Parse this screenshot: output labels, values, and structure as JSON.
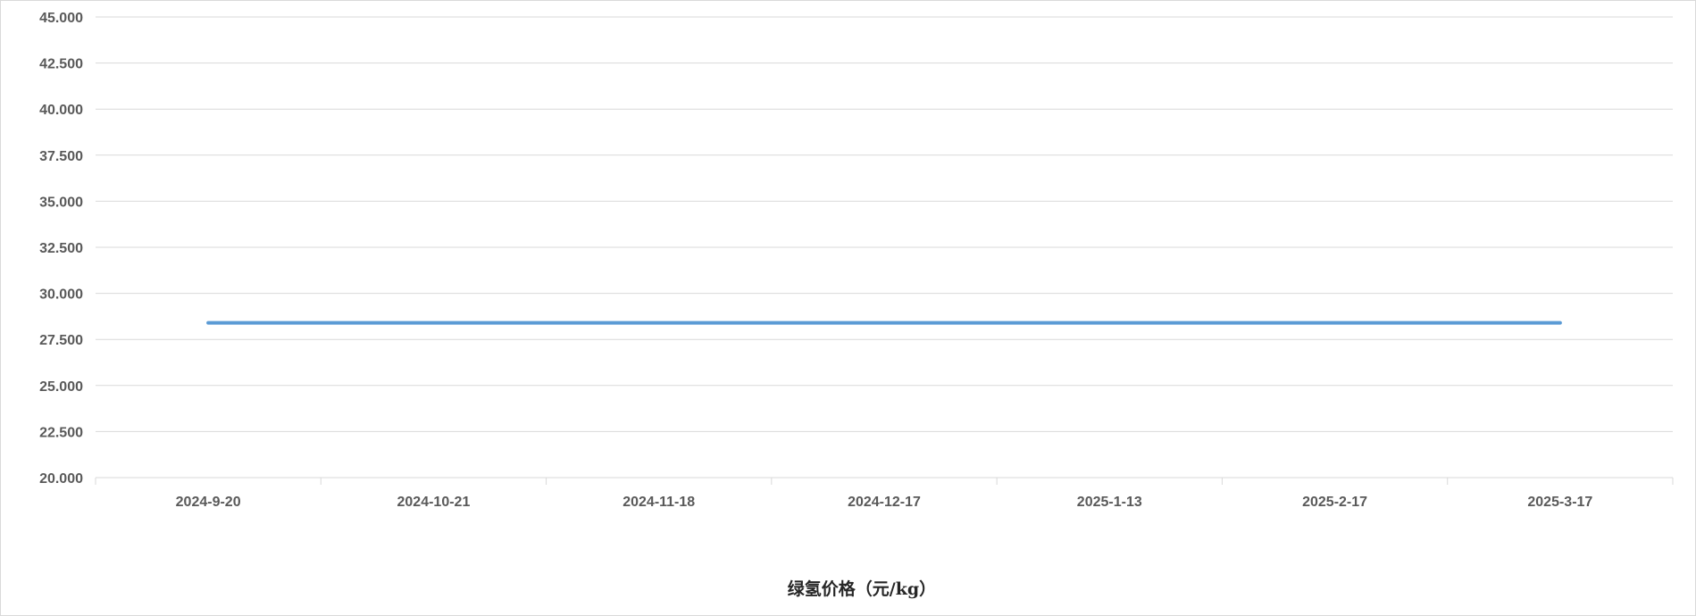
{
  "chart_data": {
    "type": "line",
    "title": "",
    "xlabel": "绿氢价格（元/kg）",
    "ylabel": "",
    "ylim": [
      20,
      45
    ],
    "yticks": [
      "20.000",
      "22.500",
      "25.000",
      "27.500",
      "30.000",
      "32.500",
      "35.000",
      "37.500",
      "40.000",
      "42.500",
      "45.000"
    ],
    "categories": [
      "2024-9-20",
      "2024-10-21",
      "2024-11-18",
      "2024-12-17",
      "2025-1-13",
      "2025-2-17",
      "2025-3-17"
    ],
    "series": [
      {
        "values": [
          28.4,
          28.4,
          28.4,
          28.4,
          28.4,
          28.4,
          28.4
        ],
        "color": "#5b9bd5"
      }
    ],
    "grid": true,
    "legend": "none"
  }
}
